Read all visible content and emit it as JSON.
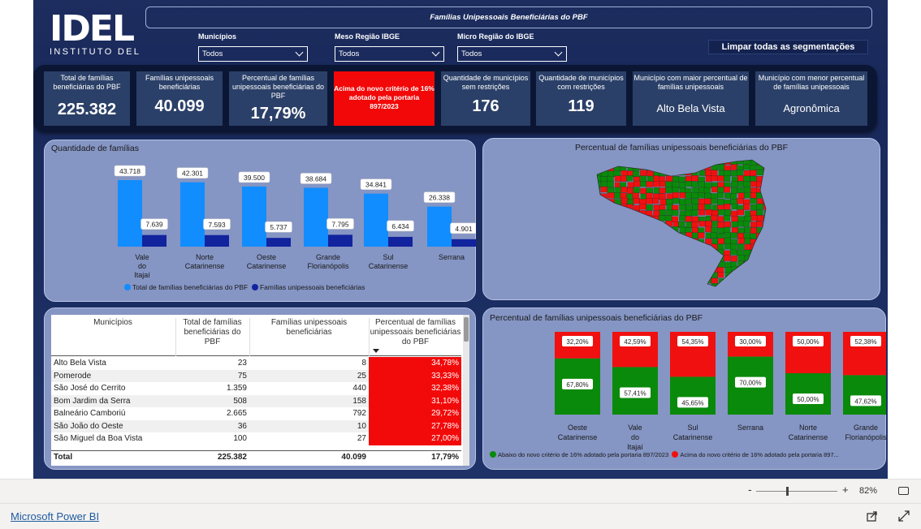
{
  "app": {
    "name": "Microsoft Power BI",
    "zoom": "82%"
  },
  "header": {
    "logo_mark": "IDEL",
    "logo_text": "INSTITUTO DEL",
    "title": "Famílias Unipessoais Beneficiárias do PBF",
    "slicers": [
      {
        "label": "Municípios",
        "value": "Todos"
      },
      {
        "label": "Meso Região IBGE",
        "value": "Todos"
      },
      {
        "label": "Micro Região do IBGE",
        "value": "Todos"
      }
    ],
    "clear_button": "Limpar todas as segmentações"
  },
  "kpis": [
    {
      "label": "Total de famílias beneficiárias do PBF",
      "value": "225.382"
    },
    {
      "label": "Famílias unipessoais beneficiárias",
      "value": "40.099"
    },
    {
      "label": "Percentual de famílias unipessoais beneficiárias do PBF",
      "value": "17,79%"
    },
    {
      "label": "Acima do novo critério de 16% adotado pela portaria 897/2023",
      "value": ""
    },
    {
      "label": "Quantidade de municípios sem restrições",
      "value": "176"
    },
    {
      "label": "Quantidade de municípios com restrições",
      "value": "119"
    },
    {
      "label": "Município com maior percentual de famílias unipessoais",
      "value": "Alto Bela Vista"
    },
    {
      "label": "Município com menor percentual de famílias unipessoais",
      "value": "Agronômica"
    }
  ],
  "bar_chart": {
    "title": "Quantidade de famílias",
    "legend": [
      "Total de famílias beneficiárias do PBF",
      "Famílias unipessoais beneficiárias"
    ],
    "colors": [
      "#118dff",
      "#12239e"
    ],
    "value_labels": [
      [
        "43.718",
        "7.639"
      ],
      [
        "42.301",
        "7.593"
      ],
      [
        "39.500",
        "5.737"
      ],
      [
        "38.684",
        "7.795"
      ],
      [
        "34.841",
        "6.434"
      ],
      [
        "26.338",
        "4.901"
      ]
    ],
    "category_labels": [
      "Vale do Itajaí",
      "Norte Catarinense",
      "Oeste Catarinense",
      "Grande Florianópolis",
      "Sul Catarinense",
      "Serrana"
    ]
  },
  "map": {
    "title": "Percentual de famílias unipessoais beneficiárias do PBF",
    "colors": [
      "#0a8a0a",
      "#f01010"
    ]
  },
  "table": {
    "headers": [
      "Municípios",
      "Total de famílias beneficiárias do PBF",
      "Famílias unipessoais beneficiárias",
      "Percentual de famílias unipessoais beneficiárias do PBF"
    ],
    "rows": [
      [
        "Alto Bela Vista",
        "23",
        "8",
        "34,78%"
      ],
      [
        "Pomerode",
        "75",
        "25",
        "33,33%"
      ],
      [
        "São José do Cerrito",
        "1.359",
        "440",
        "32,38%"
      ],
      [
        "Bom Jardim da Serra",
        "508",
        "158",
        "31,10%"
      ],
      [
        "Balneário Camboriú",
        "2.665",
        "792",
        "29,72%"
      ],
      [
        "São João do Oeste",
        "36",
        "10",
        "27,78%"
      ],
      [
        "São Miguel da Boa Vista",
        "100",
        "27",
        "27,00%"
      ]
    ],
    "total": [
      "Total",
      "225.382",
      "40.099",
      "17,79%"
    ]
  },
  "stacked_chart": {
    "title": "Percentual de famílias unipessoais beneficiárias do PBF",
    "legend": [
      "Abaixo do novo critério de 16% adotado pela portaria 897/2023",
      "Acima do novo critério de 16% adotado pela portaria 897..."
    ],
    "colors": [
      "#0a8a0a",
      "#f01010"
    ]
  },
  "chart_data": [
    {
      "type": "bar",
      "title": "Quantidade de famílias",
      "categories": [
        "Vale do Itajaí",
        "Norte Catarinense",
        "Oeste Catarinense",
        "Grande Florianópolis",
        "Sul Catarinense",
        "Serrana"
      ],
      "series": [
        {
          "name": "Total de famílias beneficiárias do PBF",
          "values": [
            43718,
            42301,
            39500,
            38684,
            34841,
            26338
          ]
        },
        {
          "name": "Famílias unipessoais beneficiárias",
          "values": [
            7639,
            7593,
            5737,
            7795,
            6434,
            4901
          ]
        }
      ],
      "legend": "bottom",
      "grid": false
    },
    {
      "type": "bar",
      "stacked": true,
      "percent": true,
      "title": "Percentual de famílias unipessoais beneficiárias do PBF",
      "categories": [
        "Oeste Catarinense",
        "Vale do Itajaí",
        "Sul Catarinense",
        "Serrana",
        "Norte Catarinense",
        "Grande Florianópolis"
      ],
      "series": [
        {
          "name": "Abaixo do novo critério de 16% adotado pela portaria 897/2023",
          "values": [
            67.8,
            57.41,
            45.65,
            70.0,
            50.0,
            47.62
          ],
          "labels": [
            "67,80%",
            "57,41%",
            "45,65%",
            "70,00%",
            "50,00%",
            "47,62%"
          ]
        },
        {
          "name": "Acima do novo critério de 16% adotado pela portaria 897/2023",
          "values": [
            32.2,
            42.59,
            54.35,
            30.0,
            50.0,
            52.38
          ],
          "labels": [
            "32,20%",
            "42,59%",
            "54,35%",
            "30,00%",
            "50,00%",
            "52,38%"
          ]
        }
      ],
      "legend": "bottom"
    }
  ]
}
